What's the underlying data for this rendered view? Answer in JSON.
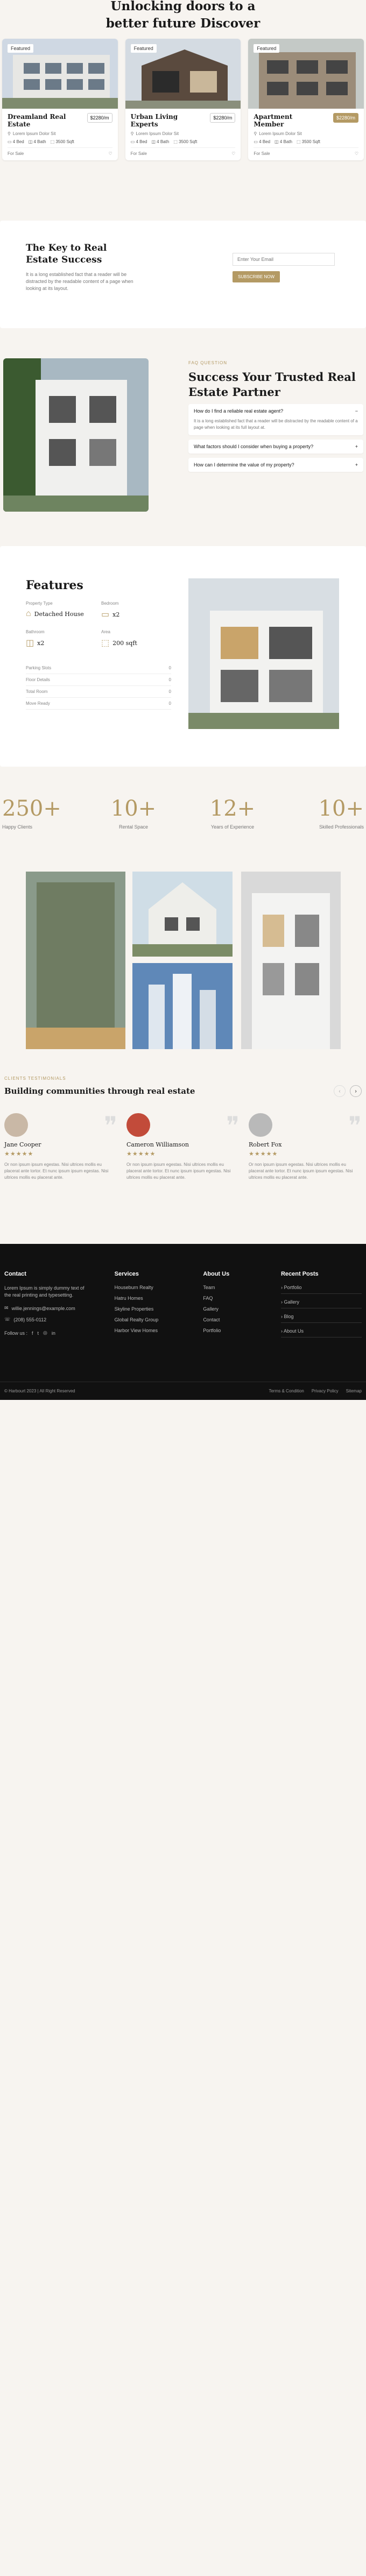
{
  "hero": {
    "title": "Unlocking doors to a better future Discover"
  },
  "properties": [
    {
      "tag": "Featured",
      "name": "Dreamland Real Estate",
      "price": "$2280/m",
      "highlight": false,
      "address": "Lorem Ipsum Dolor Sit",
      "beds": "4 Bed",
      "baths": "4 Bath",
      "area": "3500 Sqft",
      "status": "For Sale"
    },
    {
      "tag": "Featured",
      "name": "Urban Living Experts",
      "price": "$2280/m",
      "highlight": false,
      "address": "Lorem Ipsum Dolor Sit",
      "beds": "4 Bed",
      "baths": "4 Bath",
      "area": "3500 Sqft",
      "status": "For Sale"
    },
    {
      "tag": "Featured",
      "name": "Apartment Member",
      "price": "$2280/m",
      "highlight": true,
      "address": "Lorem Ipsum Dolor Sit",
      "beds": "4 Bed",
      "baths": "4 Bath",
      "area": "3500 Sqft",
      "status": "For Sale"
    }
  ],
  "newsletter": {
    "title": "The Key to Real Estate Success",
    "text": "It is a long established fact that a reader will be distracted by the readable content of a page when looking at its layout.",
    "placeholder": "Enter Your Email",
    "button": "SUBSCRIBE NOW"
  },
  "faq": {
    "eyebrow": "FAQ QUESTION",
    "title": "Success Your Trusted Real Estate Partner",
    "items": [
      {
        "q": "How do I find a reliable real estate agent?",
        "a": "It is a long established fact that a reader will be distracted by the readable content of a page when looking at its full layout at.",
        "open": true,
        "icon": "−"
      },
      {
        "q": "What factors should I consider when buying a property?",
        "a": "",
        "open": false,
        "icon": "+"
      },
      {
        "q": "How can I determine the value of my property?",
        "a": "",
        "open": false,
        "icon": "+"
      }
    ]
  },
  "features": {
    "title": "Features",
    "items": [
      {
        "label": "Property Type",
        "value": "Detached House"
      },
      {
        "label": "Bedroom",
        "value": "x2"
      },
      {
        "label": "Bathroom",
        "value": "x2"
      },
      {
        "label": "Area",
        "value": "200 sqft"
      }
    ],
    "rows": [
      {
        "label": "Parking Slots",
        "value": "0"
      },
      {
        "label": "Floor Details",
        "value": "0"
      },
      {
        "label": "Total Room",
        "value": "0"
      },
      {
        "label": "Move Ready",
        "value": "0"
      }
    ]
  },
  "stats": [
    {
      "number": "250+",
      "label": "Happy Clients"
    },
    {
      "number": "10+",
      "label": "Rental Space"
    },
    {
      "number": "12+",
      "label": "Years of Experience"
    },
    {
      "number": "10+",
      "label": "Skilled Professionals"
    }
  ],
  "testimonials": {
    "eyebrow": "CLIENTS TESTIMONIALS",
    "title": "Building communities through real estate",
    "items": [
      {
        "name": "Jane Cooper",
        "stars": "★★★★★",
        "text": "Or non ipsum ipsum egestas. Nisi ultrices mollis eu placerat ante tortor. Et nunc ipsum ipsum egestas. Nisi ultrices mollis eu placerat ante."
      },
      {
        "name": "Cameron Williamson",
        "stars": "★★★★★",
        "text": "Or non ipsum ipsum egestas. Nisi ultrices mollis eu placerat ante tortor. Et nunc ipsum ipsum egestas. Nisi ultrices mollis eu placerat ante."
      },
      {
        "name": "Robert Fox",
        "stars": "★★★★★",
        "text": "Or non ipsum ipsum egestas. Nisi ultrices mollis eu placerat ante tortor. Et nunc ipsum ipsum egestas. Nisi ultrices mollis eu placerat ante."
      }
    ]
  },
  "footer": {
    "contact": {
      "title": "Contact",
      "text": "Lorem Ipsum is simply dummy text of the real printing and typesetting.",
      "email": "willie.jennings@example.com",
      "phone": "(208) 555-0112",
      "follow": "Follow us :"
    },
    "services": {
      "title": "Services",
      "items": [
        "Houseburn Realty",
        "Hatru Homes",
        "Skyline Properties",
        "Global Realty Group",
        "Harbor View Homes"
      ]
    },
    "about": {
      "title": "About Us",
      "items": [
        "Team",
        "FAQ",
        "Gallery",
        "Contact",
        "Portfolio"
      ]
    },
    "posts": {
      "title": "Recent Posts",
      "items": [
        "Portfolio",
        "Gallery",
        "Blog",
        "About Us"
      ]
    },
    "copyright": "© Harbourt 2023 | All Right Reserved",
    "links": [
      "Terms & Condition",
      "Privacy Policy",
      "Sitemap"
    ]
  },
  "colors": {
    "accent": "#b49a64",
    "bg": "#f7f4f0",
    "footer": "#111111"
  }
}
